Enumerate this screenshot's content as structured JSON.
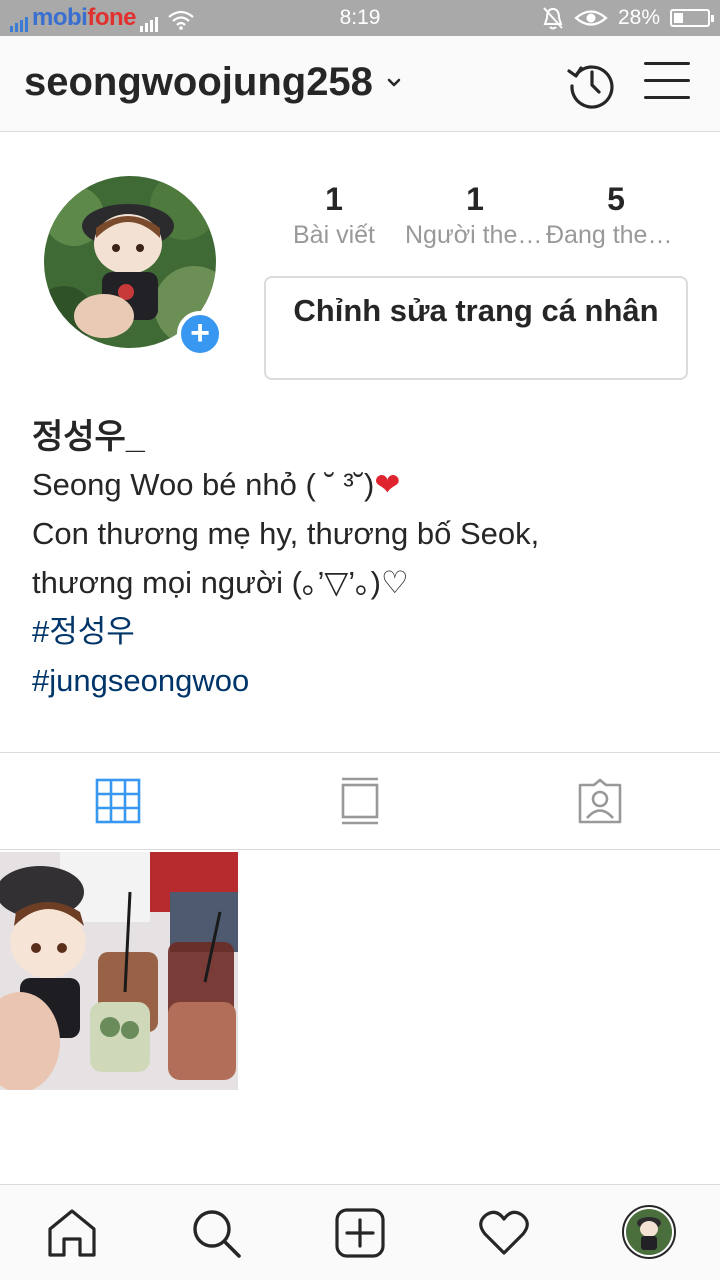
{
  "status_bar": {
    "carrier_main": "mobi",
    "carrier_accent": "fone",
    "time": "8:19",
    "battery_text": "28%",
    "battery_level": 0.28
  },
  "header": {
    "username": "seongwoojung258"
  },
  "profile": {
    "stats": [
      {
        "value": "1",
        "label": "Bài viết"
      },
      {
        "value": "1",
        "label": "Người theo dõi"
      },
      {
        "value": "5",
        "label": "Đang theo dõi"
      }
    ],
    "edit_label": "Chỉnh sửa trang cá nhân",
    "add_icon": "+"
  },
  "bio": {
    "name": "정성우_",
    "line1": "Seong Woo bé nhỏ ( ˘ ³˘)",
    "line1_heart": "❤",
    "line2": "Con thương mẹ hy, thương bố Seok,",
    "line3": "thương mọi người (｡’▽’｡)♡",
    "hashtags": [
      "#정성우",
      "#jungseongwoo"
    ]
  },
  "colors": {
    "link_blue": "#3897f0",
    "hashtag": "#003569",
    "border": "#dbdbdb",
    "muted": "#999999"
  },
  "icons": {
    "tab_active": "grid-icon",
    "tab_2": "igtv-icon",
    "tab_3": "tagged-icon",
    "nav": [
      "home-icon",
      "search-icon",
      "new-post-icon",
      "activity-heart-icon",
      "profile-avatar"
    ]
  }
}
